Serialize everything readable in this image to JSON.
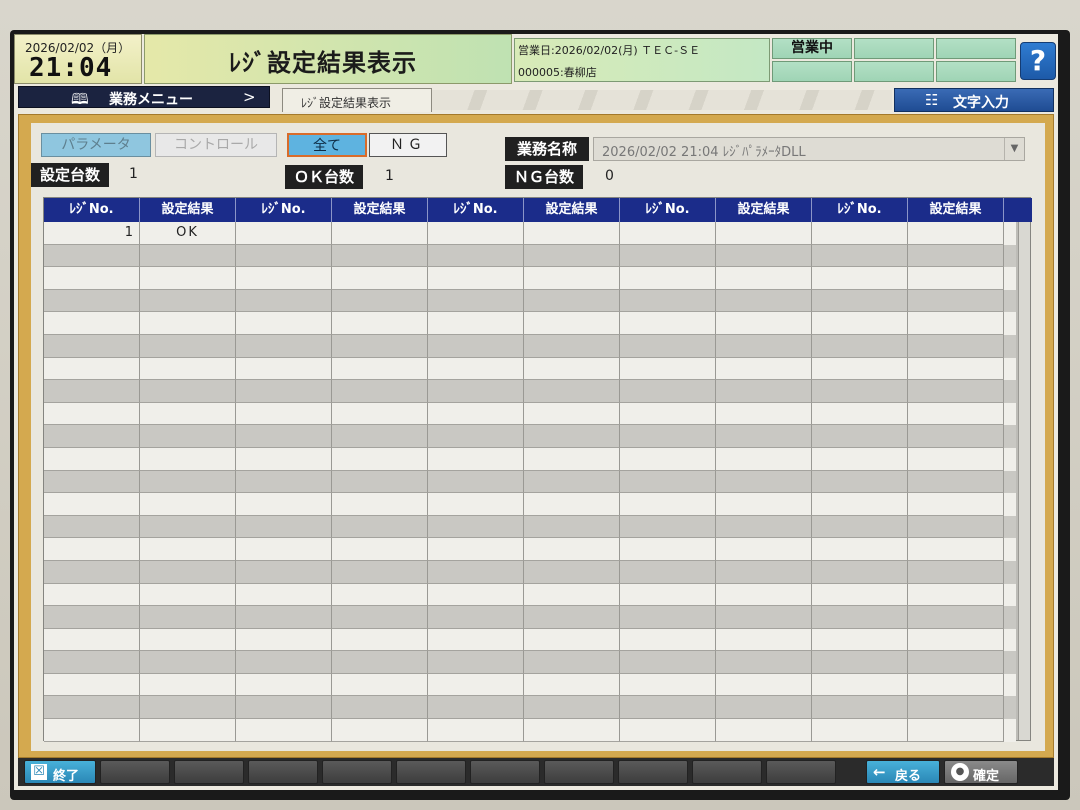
{
  "header": {
    "date": "2026/02/02（月）",
    "time": "21:04",
    "title": "ﾚｼﾞ設定結果表示",
    "business_day_line": "営業日:2026/02/02(月) ＴＥＣ-ＳＥ",
    "store_line": "000005:春柳店",
    "status": "営業中",
    "help_label": "?"
  },
  "nav": {
    "menu_label": "業務メニュー",
    "menu_chevron": ">",
    "active_tab": "ﾚｼﾞ設定結果表示",
    "text_input_label": "文字入力"
  },
  "filters": {
    "parameter": "パラメータ",
    "control": "コントロール",
    "all": "全て",
    "ng": "ＮＧ"
  },
  "summary": {
    "setting_count_label": "設定台数",
    "setting_count": "1",
    "ok_count_label": "ＯＫ台数",
    "ok_count": "1",
    "ng_count_label": "ＮＧ台数",
    "ng_count": "0",
    "business_name_label": "業務名称",
    "business_name_value": "2026/02/02 21:04 ﾚｼﾞﾊﾟﾗﾒｰﾀDLL"
  },
  "table": {
    "headers": [
      "ﾚｼﾞNo.",
      "設定結果",
      "ﾚｼﾞNo.",
      "設定結果",
      "ﾚｼﾞNo.",
      "設定結果",
      "ﾚｼﾞNo.",
      "設定結果",
      "ﾚｼﾞNo.",
      "設定結果"
    ],
    "rows": [
      [
        "1",
        "OK",
        "",
        "",
        "",
        "",
        "",
        "",
        "",
        ""
      ]
    ],
    "visible_row_count": 23
  },
  "footer": {
    "exit_label": "終了",
    "exit_icon": "☒",
    "back_label": "戻る",
    "back_icon": "←",
    "confirm_label": "確定",
    "confirm_icon": "●"
  },
  "colors": {
    "header_bg": "#1b2c8a",
    "panel_border": "#d4a94f",
    "accent_blue": "#2a87b6"
  }
}
